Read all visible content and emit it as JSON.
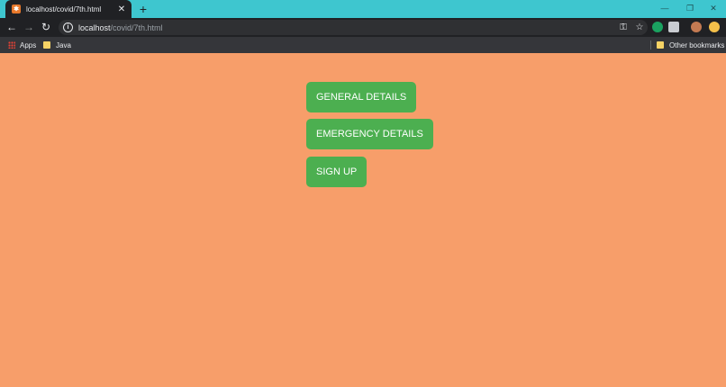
{
  "browser": {
    "tab": {
      "title": "localhost/covid/7th.html",
      "favicon": "xampp-favicon"
    },
    "new_tab_label": "+",
    "window_controls": {
      "minimize": "—",
      "restore": "❐",
      "close": "✕"
    },
    "url": {
      "host": "localhost",
      "path": "/covid/7th.html"
    },
    "bookmarks": {
      "apps": "Apps",
      "java": "Java",
      "other": "Other bookmarks"
    },
    "colors": {
      "tabstrip": "#3ec6cf",
      "toolbar": "#202124",
      "bookmarks_bar": "#35363a",
      "page_background": "#f79e6a",
      "button": "#4caf50"
    }
  },
  "page": {
    "buttons": [
      {
        "label": "GENERAL DETAILS"
      },
      {
        "label": "EMERGENCY DETAILS"
      },
      {
        "label": "SIGN UP"
      }
    ]
  }
}
